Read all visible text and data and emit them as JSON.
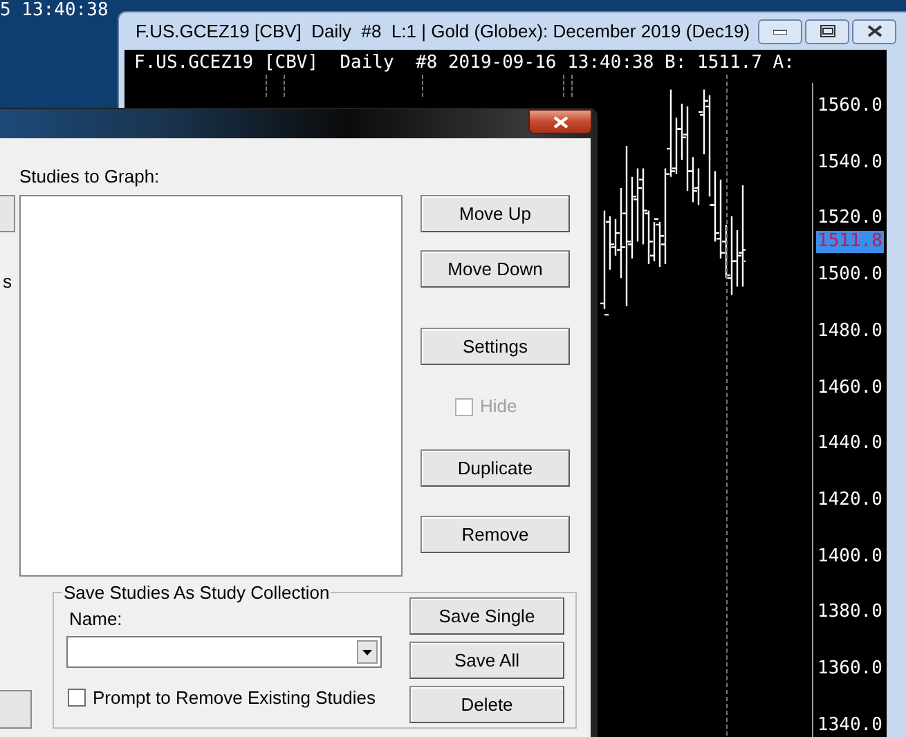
{
  "background_window": {
    "header_fragment": "5 13:40:38"
  },
  "chart_window": {
    "title": "F.US.GCEZ19 [CBV]  Daily  #8  L:1 | Gold (Globex): December 2019 (Dec19)",
    "header": "F.US.GCEZ19 [CBV]  Daily  #8 2019-09-16 13:40:38 B: 1511.7 A:",
    "price_axis": {
      "labels": [
        "1560.0",
        "1540.0",
        "1520.0",
        "1500.0",
        "1480.0",
        "1460.0",
        "1440.0",
        "1420.0",
        "1400.0",
        "1380.0",
        "1360.0",
        "1340.0"
      ],
      "current_price": "1511.8"
    }
  },
  "dialog": {
    "list_label": "Studies to Graph:",
    "left_fragment": "s",
    "controls": [
      {
        "kind": "button",
        "label": "Move Up"
      },
      {
        "kind": "button",
        "label": "Move Down"
      },
      {
        "kind": "button",
        "label": "Settings"
      },
      {
        "kind": "checkbox",
        "label": "Hide",
        "checked": false,
        "disabled": true
      },
      {
        "kind": "button",
        "label": "Duplicate"
      },
      {
        "kind": "button",
        "label": "Remove"
      }
    ],
    "collection": {
      "title": "Save Studies As Study Collection",
      "name_label": "Name:",
      "prompt": {
        "label": "Prompt to Remove Existing Studies",
        "checked": false
      },
      "buttons": [
        "Save Single",
        "Save All",
        "Delete"
      ]
    }
  }
}
